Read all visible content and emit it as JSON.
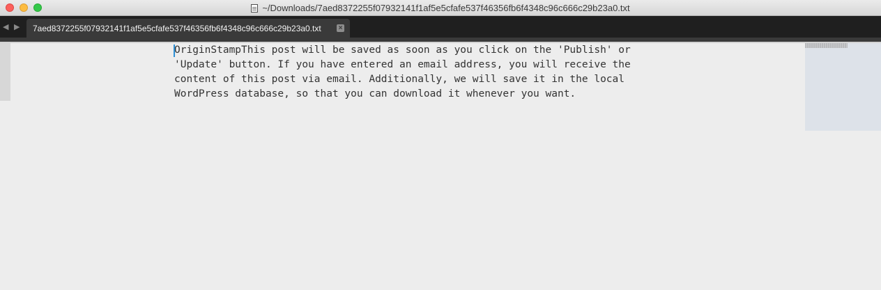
{
  "window": {
    "title": "~/Downloads/7aed8372255f07932141f1af5e5cfafe537f46356fb6f4348c96c666c29b23a0.txt",
    "controls": [
      "close",
      "minimize",
      "maximize"
    ]
  },
  "navigation": {
    "back_icon": "◀",
    "forward_icon": "▶"
  },
  "tabs": [
    {
      "label": "7aed8372255f07932141f1af5e5cfafe537f46356fb6f4348c96c666c29b23a0.txt",
      "active": true,
      "close_icon": "×"
    }
  ],
  "editor": {
    "lines": [
      "OriginStampThis post will be saved as soon as you click on the 'Publish' or",
      "'Update' button. If you have entered an email address, you will receive the",
      "content of this post via email. Additionally, we will save it in the local",
      "WordPress database, so that you can download it whenever you want."
    ]
  },
  "colors": {
    "editor_background": "#ededed",
    "tabbar_background": "#1f1f1f",
    "active_tab": "#3a3a3a",
    "caret": "#2d8fd5",
    "minimap": "#dde2e9"
  }
}
